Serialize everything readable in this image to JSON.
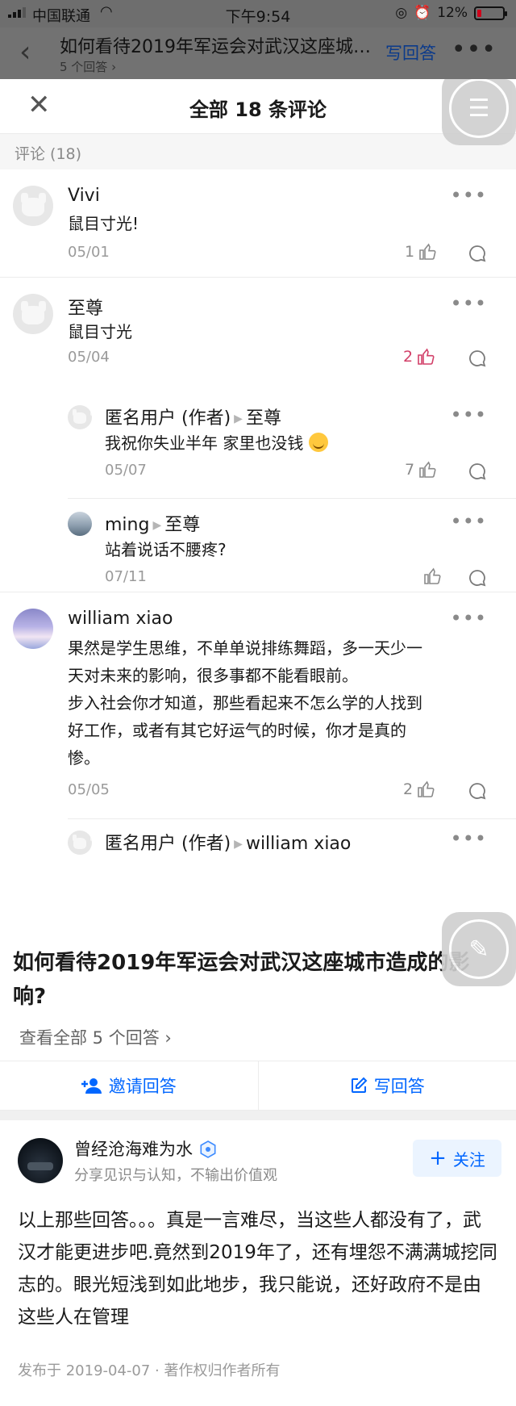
{
  "status_bar": {
    "carrier": "中国联通",
    "time": "下午9:54",
    "battery": "12%",
    "battery_level": 0.12
  },
  "nav": {
    "title": "如何看待2019年军运会对武汉这座城市造成的影响?",
    "answer_count": "5 个回答 ›",
    "write_answer": "写回答"
  },
  "sheet": {
    "title": "全部 18 条评论",
    "section_label": "评论 (18)"
  },
  "comments": [
    {
      "name": "Vivi",
      "text": "鼠目寸光!",
      "date": "05/01",
      "likes": "1",
      "liked": false
    },
    {
      "name": "至尊",
      "text": "鼠目寸光",
      "date": "05/04",
      "likes": "2",
      "liked": true
    },
    {
      "name": "匿名用户 (作者)",
      "reply_to": "至尊",
      "text": "我祝你失业半年 家里也没钱",
      "date": "05/07",
      "likes": "7",
      "liked": false
    },
    {
      "name": "ming",
      "reply_to": "至尊",
      "text": "站着说话不腰疼?",
      "date": "07/11",
      "likes": "",
      "liked": false
    },
    {
      "name": "william xiao",
      "text_lines": [
        "果然是学生思维，不单单说排练舞蹈，多一天少一",
        "天对未来的影响，很多事都不能看眼前。",
        "步入社会你才知道，那些看起来不怎么学的人找到",
        "好工作，或者有其它好运气的时候，你才是真的",
        "惨。"
      ],
      "date": "05/05",
      "likes": "2",
      "liked": false
    },
    {
      "name": "匿名用户 (作者)",
      "reply_to": "william xiao"
    }
  ],
  "question": {
    "title": "如何看待2019年军运会对武汉这座城市造成的影响?",
    "view_all": "查看全部 5 个回答",
    "invite": "邀请回答",
    "write": "写回答"
  },
  "answer": {
    "author": "曾经沧海难为水",
    "bio": "分享见识与认知，不输出价值观",
    "follow": "关注",
    "text": "以上那些回答。。。真是一言难尽，当这些人都没有了，武汉才能更进步吧.竟然到2019年了，还有埋怨不满满城挖同志的。眼光短浅到如此地步，我只能说，还好政府不是由这些人在管理",
    "meta": "发布于 2019-04-07 · 著作权归作者所有"
  },
  "colors": {
    "link_blue": "#0066ff",
    "like_active": "#d23f68",
    "muted": "#9a9a9a"
  }
}
